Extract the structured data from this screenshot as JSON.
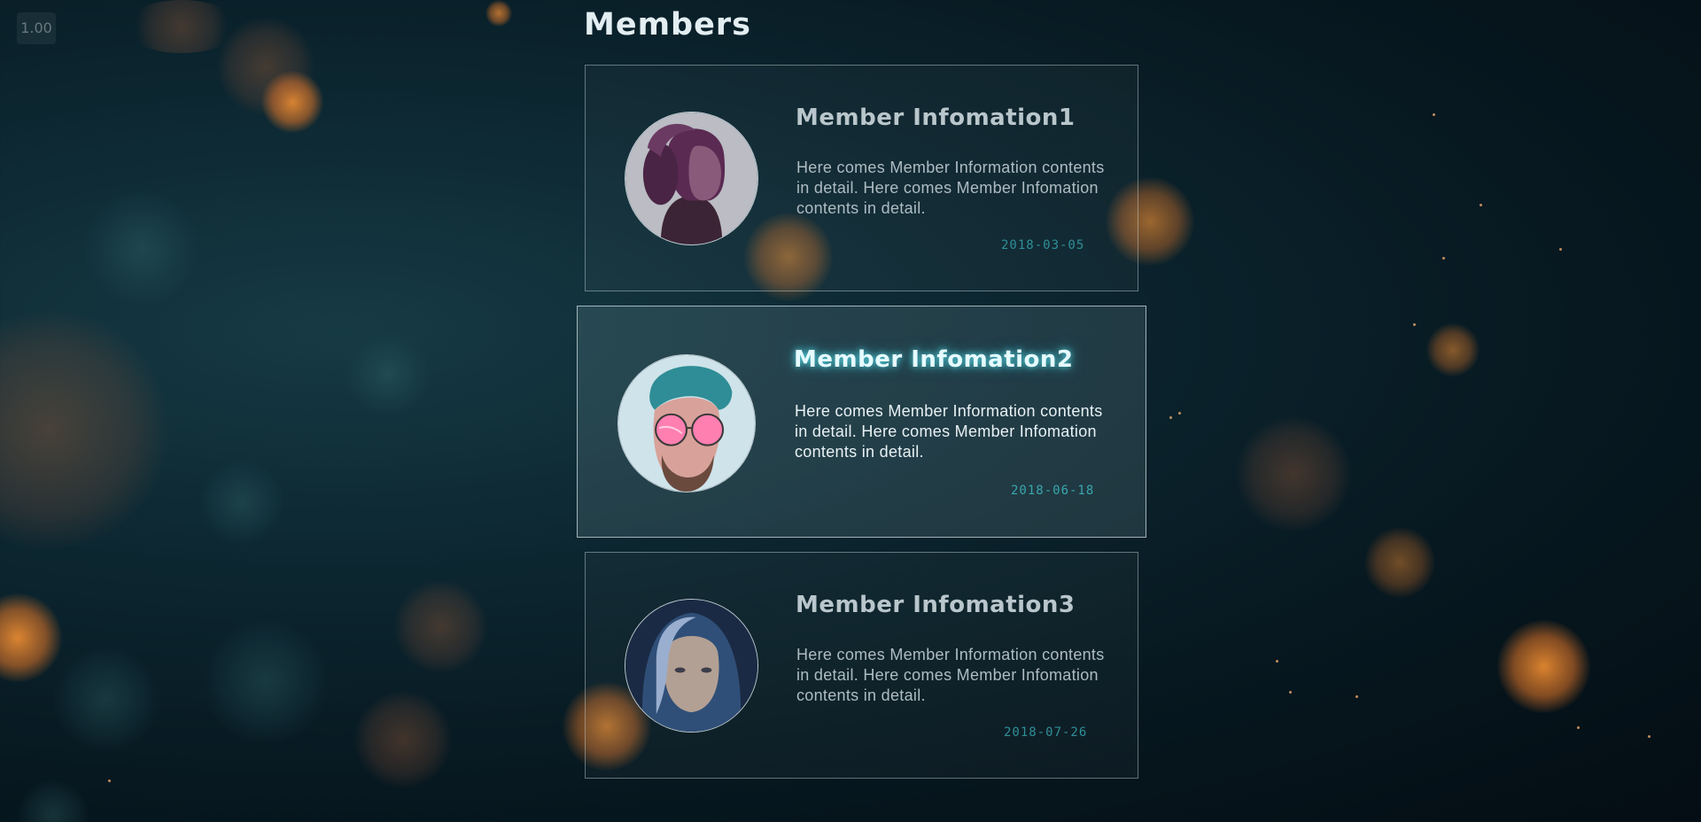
{
  "zoom_level": "1.00",
  "page_title": "Members",
  "members": [
    {
      "title": "Member Infomation1",
      "description": "Here comes Member Information contents in detail. Here comes Member Infomation contents in detail.",
      "date": "2018-03-05",
      "avatar": "avatar-woman-purple-tone"
    },
    {
      "title": "Member Infomation2",
      "description": "Here comes Member Information contents in detail. Here comes Member Infomation contents in detail.",
      "date": "2018-06-18",
      "avatar": "avatar-man-sunglasses"
    },
    {
      "title": "Member Infomation3",
      "description": "Here comes Member Information contents in detail. Here comes Member Infomation contents in detail.",
      "date": "2018-07-26",
      "avatar": "avatar-girl-blue-tone"
    }
  ],
  "colors": {
    "title_glow": "#5ae6f0",
    "date": "#2f8f97",
    "card_border": "#c8d7dc"
  }
}
